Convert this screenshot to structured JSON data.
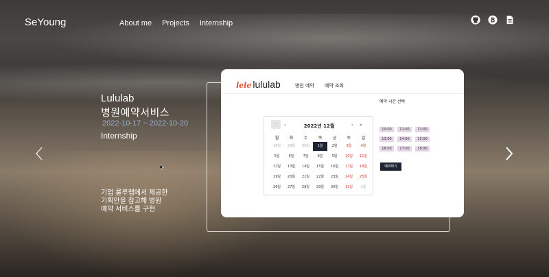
{
  "header": {
    "brand": "SeYoung",
    "nav": [
      "About me",
      "Projects",
      "Internship"
    ],
    "icons": [
      "github-icon",
      "blog-icon",
      "document-icon"
    ]
  },
  "slide": {
    "title_line1": "Lululab",
    "title_line2": "병원예약서비스",
    "date": "2022-10-17 ~ 2022-10-20",
    "category": "Internship",
    "description": "기업 룰루랩에서 제공한\n기획안을 참고해 병원\n예약 서비스를 구현"
  },
  "preview": {
    "logo_mark": "lele",
    "logo_text": "lululab",
    "nav": [
      "병원 예약",
      "예약 조회"
    ],
    "calendar": {
      "today_btn": "·",
      "prev": "‹",
      "next": "›",
      "next2": "»",
      "title": "2022년 12월",
      "weekdays": [
        "월",
        "화",
        "수",
        "목",
        "금",
        "토",
        "일"
      ],
      "weeks": [
        [
          "28일",
          "29일",
          "30일",
          "1일",
          "2일",
          "3일",
          "4일"
        ],
        [
          "5일",
          "6일",
          "7일",
          "8일",
          "9일",
          "10일",
          "11일"
        ],
        [
          "12일",
          "13일",
          "14일",
          "15일",
          "16일",
          "17일",
          "18일"
        ],
        [
          "19일",
          "20일",
          "21일",
          "22일",
          "23일",
          "24일",
          "25일"
        ],
        [
          "26일",
          "27일",
          "28일",
          "29일",
          "30일",
          "31일",
          "1일"
        ]
      ],
      "selected": "1일"
    },
    "slot_title": "예약 시간 선택",
    "slots": [
      "10:00",
      "11:00",
      "12:00",
      "13:00",
      "14:00",
      "15:00",
      "16:00",
      "17:00",
      "18:00"
    ],
    "reserve_label": "예약하기"
  },
  "colors": {
    "accent_dark": "#1c2333",
    "slot_bg": "#e5d6e8",
    "date_text": "#9bb0d3",
    "weekend_red": "#d0342c",
    "logo_red": "#e0533f"
  }
}
